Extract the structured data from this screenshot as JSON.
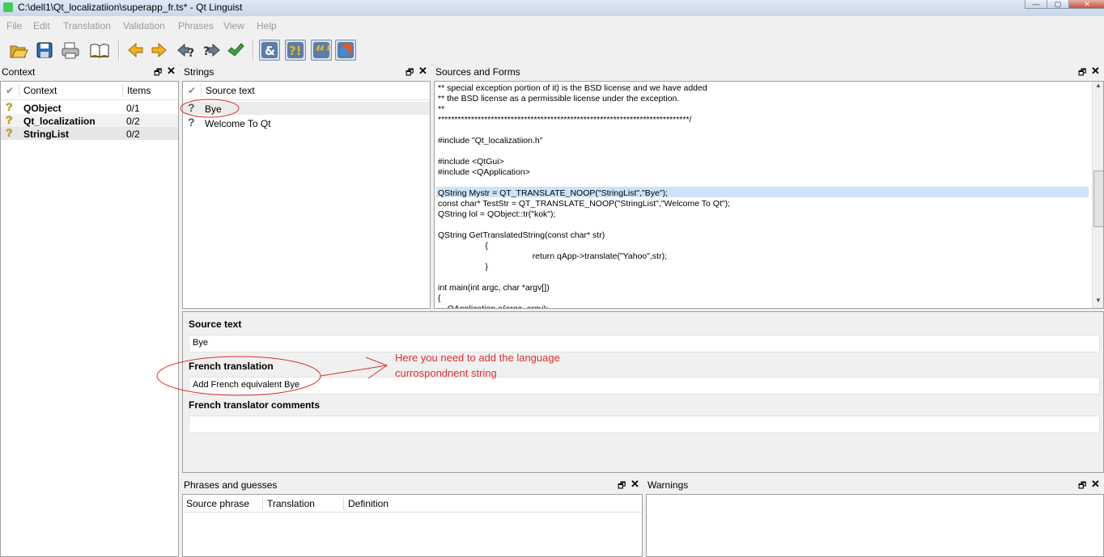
{
  "window": {
    "title": "C:\\dell1\\Qt_localizatiion\\superapp_fr.ts* - Qt Linguist"
  },
  "menu": [
    "File",
    "Edit",
    "Translation",
    "Validation",
    "Phrases",
    "View",
    "Help"
  ],
  "toolbar": {
    "items": [
      "open-icon",
      "save-icon",
      "print-icon",
      "phrasebook-icon",
      "prev-icon",
      "next-icon",
      "prev-unfinished-icon",
      "next-unfinished-icon",
      "done-next-icon",
      "accelerators-icon",
      "punctuation-icon",
      "phrases-icon",
      "placemarkers-icon"
    ]
  },
  "context": {
    "title": "Context",
    "headers": {
      "context": "Context",
      "items": "Items"
    },
    "rows": [
      {
        "name": "QObject",
        "items": "0/1"
      },
      {
        "name": "Qt_localizatiion",
        "items": "0/2"
      },
      {
        "name": "StringList",
        "items": "0/2"
      }
    ]
  },
  "strings": {
    "title": "Strings",
    "header": "Source text",
    "rows": [
      {
        "text": "Bye"
      },
      {
        "text": "Welcome To Qt"
      }
    ]
  },
  "sources": {
    "title": "Sources and Forms",
    "lines": [
      "** special exception portion of it) is the BSD license and we have added",
      "** the BSD license as a permissible license under the exception.",
      "**",
      "****************************************************************************/",
      "",
      "#include \"Qt_localizatiion.h\"",
      "",
      "#include <QtGui>",
      "#include <QApplication>",
      "",
      "QString Mystr = QT_TRANSLATE_NOOP(\"StringList\",\"Bye\");",
      "const char* TestStr = QT_TRANSLATE_NOOP(\"StringList\",\"Welcome To Qt\");",
      "QString lol = QObject::tr(\"kok\");",
      "",
      "QString GetTranslatedString(const char* str)",
      "                    {",
      "                                        return qApp->translate(\"Yahoo\",str);",
      "                    }",
      "",
      "int main(int argc, char *argv[])",
      "{",
      "    QApplication a(argc, argv);"
    ]
  },
  "editor": {
    "source_label": "Source text",
    "source_value": "Bye",
    "translation_label": "French translation",
    "translation_value": "Add French equivalent Bye",
    "comments_label": "French translator comments",
    "comments_value": ""
  },
  "annotation": {
    "line1": "Here you need to add the language",
    "line2": "currospondnent string",
    "color": "#e03030"
  },
  "phrases": {
    "title": "Phrases and guesses",
    "headers": [
      "Source phrase",
      "Translation",
      "Definition"
    ]
  },
  "warnings": {
    "title": "Warnings"
  },
  "colors": {
    "highlight": "#cde3f8",
    "selected_row": "#ececec"
  }
}
